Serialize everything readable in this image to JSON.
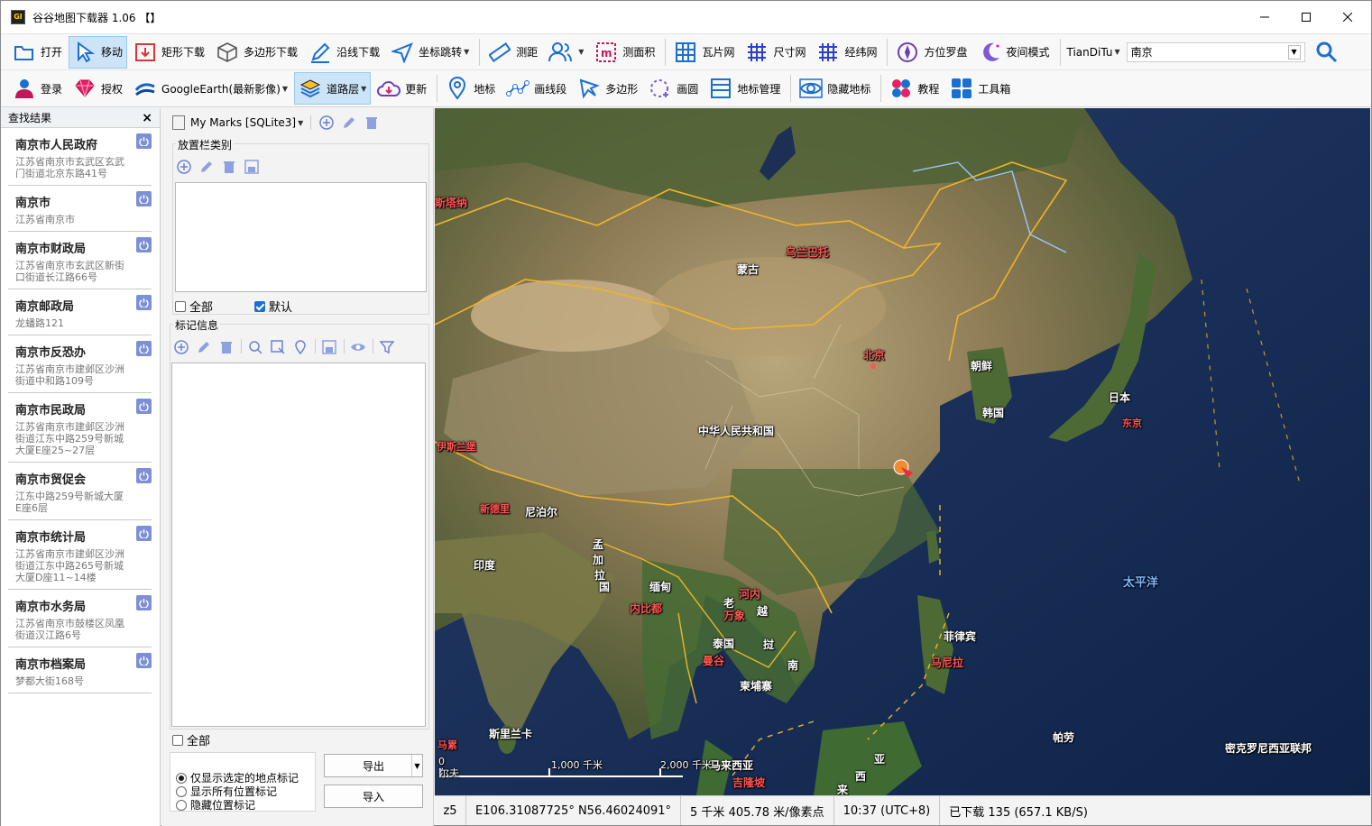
{
  "window": {
    "title": "谷谷地图下载器 1.06 【】",
    "icon_text": "GI"
  },
  "toolbar1": {
    "open": "打开",
    "move": "移动",
    "rect_download": "矩形下载",
    "polygon_download": "多边形下载",
    "line_download": "沿线下载",
    "coord_jump": "坐标跳转",
    "measure_distance": "测距",
    "measure_area": "测面积",
    "tile_grid": "瓦片网",
    "size_grid": "尺寸网",
    "latlon_grid": "经纬网",
    "compass": "方位罗盘",
    "night_mode": "夜间模式",
    "source": "TianDiTu",
    "search_value": "南京"
  },
  "toolbar2": {
    "login": "登录",
    "license": "授权",
    "google_earth": "GoogleEarth(最新影像)",
    "road_layer": "道路层",
    "update": "更新",
    "placemark": "地标",
    "draw_line": "画线段",
    "polygon": "多边形",
    "circle": "画圆",
    "mark_manage": "地标管理",
    "hide_marks": "隐藏地标",
    "tutorial": "教程",
    "toolbox": "工具箱"
  },
  "search_results": {
    "header": "查找结果",
    "items": [
      {
        "name": "南京市人民政府",
        "addr": "江苏省南京市玄武区玄武门街道北京东路41号"
      },
      {
        "name": "南京市",
        "addr": "江苏省南京市"
      },
      {
        "name": "南京市财政局",
        "addr": "江苏省南京市玄武区新街口街道长江路66号"
      },
      {
        "name": "南京邮政局",
        "addr": "龙蟠路121"
      },
      {
        "name": "南京市反恐办",
        "addr": "江苏省南京市建邺区沙洲街道中和路109号"
      },
      {
        "name": "南京市民政局",
        "addr": "江苏省南京市建邺区沙洲街道江东中路259号新城大厦E座25~27层"
      },
      {
        "name": "南京市贸促会",
        "addr": "江东中路259号新城大厦E座6层"
      },
      {
        "name": "南京市统计局",
        "addr": "江苏省南京市建邺区沙洲街道江东中路265号新城大厦D座11~14楼"
      },
      {
        "name": "南京市水务局",
        "addr": "江苏省南京市鼓楼区凤凰街道汉江路6号"
      },
      {
        "name": "南京市档案局",
        "addr": "梦都大街168号"
      }
    ]
  },
  "marks_panel": {
    "db_label": "My Marks [SQLite3]",
    "category_group": "放置栏类别",
    "all_label": "全部",
    "default_label": "默认",
    "info_group": "标记信息",
    "all_label2": "全部",
    "radio_options": [
      "仅显示选定的地点标记",
      "显示所有位置标记",
      "隐藏位置标记"
    ],
    "export": "导出",
    "import": "导入"
  },
  "map": {
    "labels": [
      {
        "text": "乌兰巴托",
        "kind": "city"
      },
      {
        "text": "蒙古",
        "kind": "country"
      },
      {
        "text": "北京",
        "kind": "city"
      },
      {
        "text": "朝鲜",
        "kind": "country"
      },
      {
        "text": "韩国",
        "kind": "country"
      },
      {
        "text": "日本",
        "kind": "country"
      },
      {
        "text": "东京",
        "kind": "city"
      },
      {
        "text": "中华人民共和国",
        "kind": "country"
      },
      {
        "text": "伊斯兰堡",
        "kind": "city"
      },
      {
        "text": "新德里",
        "kind": "city"
      },
      {
        "text": "尼泊尔",
        "kind": "country"
      },
      {
        "text": "印度",
        "kind": "country"
      },
      {
        "text": "缅甸",
        "kind": "country"
      },
      {
        "text": "内比都",
        "kind": "city"
      },
      {
        "text": "河内",
        "kind": "city"
      },
      {
        "text": "老",
        "kind": "country"
      },
      {
        "text": "万象",
        "kind": "city"
      },
      {
        "text": "越",
        "kind": "country"
      },
      {
        "text": "泰国",
        "kind": "country"
      },
      {
        "text": "挝",
        "kind": "country"
      },
      {
        "text": "曼谷",
        "kind": "city"
      },
      {
        "text": "南",
        "kind": "country"
      },
      {
        "text": "柬埔寨",
        "kind": "country"
      },
      {
        "text": "菲律宾",
        "kind": "country"
      },
      {
        "text": "马尼拉",
        "kind": "city"
      },
      {
        "text": "太平洋",
        "kind": "ocean"
      },
      {
        "text": "斯里兰卡",
        "kind": "country"
      },
      {
        "text": "马累",
        "kind": "city"
      },
      {
        "text": "马来西亚",
        "kind": "country"
      },
      {
        "text": "吉隆坡",
        "kind": "city"
      },
      {
        "text": "亚",
        "kind": "country"
      },
      {
        "text": "西",
        "kind": "country"
      },
      {
        "text": "来",
        "kind": "country"
      },
      {
        "text": "帕劳",
        "kind": "country"
      },
      {
        "text": "密克罗尼西亚联邦",
        "kind": "country"
      },
      {
        "text": "斯塔纳",
        "kind": "city"
      },
      {
        "text": "孟",
        "kind": "country"
      },
      {
        "text": "加",
        "kind": "country"
      },
      {
        "text": "拉",
        "kind": "country"
      },
      {
        "text": "国",
        "kind": "country"
      }
    ],
    "scale": {
      "mid": "1,000 千米",
      "end": "2,000 千米",
      "start": "0",
      "edge": "尔夫"
    }
  },
  "status": {
    "zoom": "z5",
    "coords": "E106.31087725° N56.46024091°",
    "resolution": "5 千米 405.78 米/像素点",
    "time": "10:37 (UTC+8)",
    "downloaded": "已下载 135 (657.1 KB/S)"
  },
  "colors": {
    "accent": "#1a6fd1",
    "active_bg": "#cce4f7",
    "power_icon": "#7d8fd6",
    "border_yellow": "#f0b429",
    "city_red": "#ff5454"
  }
}
